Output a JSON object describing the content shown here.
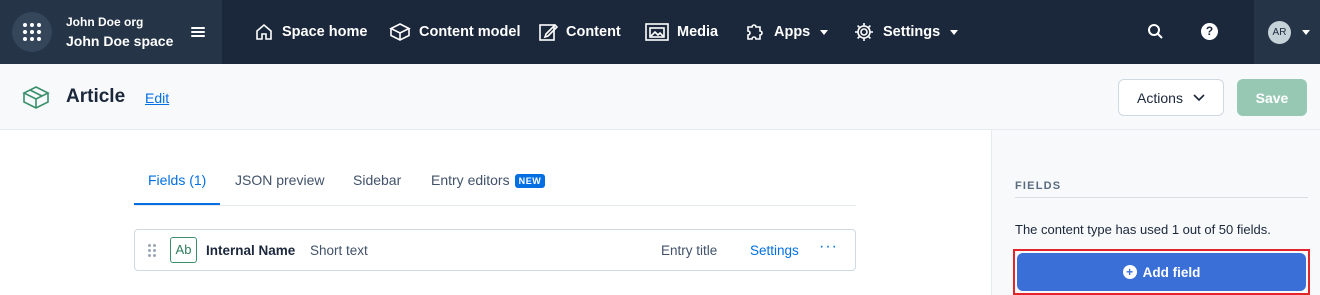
{
  "nav": {
    "org": "John Doe org",
    "space": "John Doe space",
    "items": [
      {
        "label": "Space home",
        "icon": "home-icon"
      },
      {
        "label": "Content model",
        "icon": "content-model-icon"
      },
      {
        "label": "Content",
        "icon": "content-icon"
      },
      {
        "label": "Media",
        "icon": "media-icon"
      },
      {
        "label": "Apps",
        "icon": "apps-puzzle-icon"
      },
      {
        "label": "Settings",
        "icon": "gear-icon"
      }
    ],
    "help": "?",
    "avatar_initials": "AR"
  },
  "header": {
    "title": "Article",
    "edit": "Edit",
    "actions": "Actions",
    "save": "Save"
  },
  "tabs": [
    {
      "label": "Fields (1)",
      "active": true
    },
    {
      "label": "JSON preview"
    },
    {
      "label": "Sidebar"
    },
    {
      "label": "Entry editors",
      "badge": "NEW"
    }
  ],
  "fields": [
    {
      "type_icon": "Ab",
      "name": "Internal Name",
      "type": "Short text",
      "role": "Entry title",
      "settings": "Settings",
      "more": "···"
    }
  ],
  "sidebar": {
    "heading": "FIELDS",
    "usage": "The content type has used 1 out of 50 fields.",
    "add_field": "Add field"
  },
  "colors": {
    "nav_bg": "#1b273a",
    "primary": "#036fe3",
    "save_disabled": "#97c8b4",
    "add_field_bg": "#3a6fd8",
    "highlight": "#e3242b"
  }
}
